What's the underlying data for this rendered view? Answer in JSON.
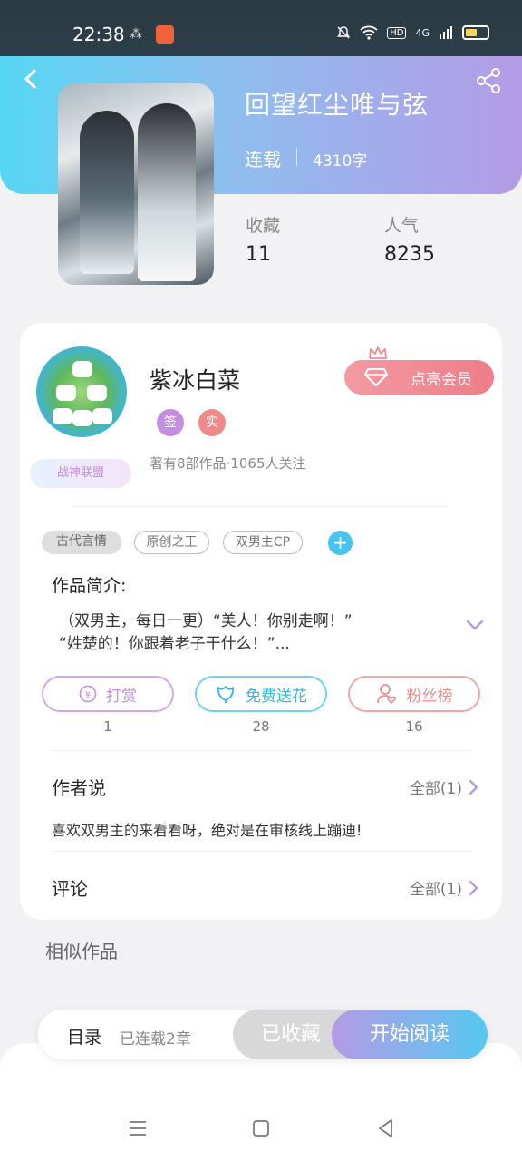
{
  "status_bar": {
    "time": "22:38",
    "notif": "⁂",
    "network": "4G"
  },
  "book": {
    "title": "回望红尘唯与弦",
    "status": "连载",
    "words": "4310字",
    "stats": [
      {
        "label": "收藏",
        "value": "11"
      },
      {
        "label": "人气",
        "value": "8235"
      }
    ]
  },
  "author": {
    "name": "紫冰白菜",
    "badges": [
      "签",
      "实"
    ],
    "union": "战神联盟",
    "info": "著有8部作品·1065人关注",
    "vip_button": "点亮会员"
  },
  "tags": [
    "古代言情",
    "原创之王",
    "双男主CP"
  ],
  "intro": {
    "title": "作品简介:",
    "lines": [
      "（双男主，每日一更）“美人！你别走啊！”",
      "“姓楚的！你跟着老子干什么！”..."
    ]
  },
  "actions": [
    {
      "label": "打赏",
      "count": "1",
      "color": "#c88be0"
    },
    {
      "label": "免费送花",
      "count": "28",
      "color": "#45c2e8"
    },
    {
      "label": "粉丝榜",
      "count": "16",
      "color": "#ee8c8c"
    }
  ],
  "author_says": {
    "title": "作者说",
    "more": "全部(1)",
    "text": "喜欢双男主的来看看呀，绝对是在审核线上蹦迪!"
  },
  "comments": {
    "title": "评论",
    "more": "全部(1)"
  },
  "similar_title": "相似作品",
  "bottom_bar": {
    "toc": "目录",
    "toc_sub": "已连载2章",
    "collected": "已收藏",
    "start": "开始阅读"
  }
}
